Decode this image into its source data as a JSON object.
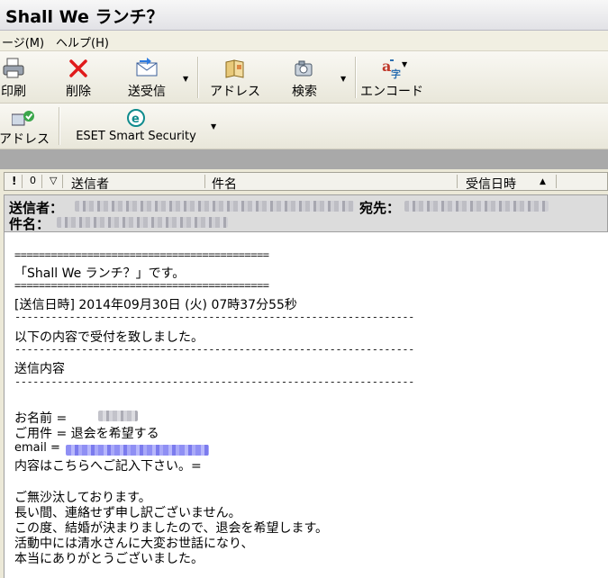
{
  "window": {
    "title": "Shall We ランチ？"
  },
  "menubar": {
    "items": [
      "ージ(M)",
      "ヘルプ(H)"
    ]
  },
  "toolbar": {
    "buttons": [
      {
        "label": "印刷",
        "icon": "printer-icon"
      },
      {
        "label": "削除",
        "icon": "delete-x-icon"
      },
      {
        "label": "送受信",
        "icon": "send-receive-icon"
      },
      {
        "label": "アドレス",
        "icon": "address-book-icon"
      },
      {
        "label": "検索",
        "icon": "search-icon"
      },
      {
        "label": "エンコード",
        "icon": "encoding-icon"
      }
    ]
  },
  "toolbar2": {
    "buttons": [
      {
        "label": "アドレス",
        "icon": "address-check-icon"
      },
      {
        "label": "ESET Smart Security",
        "icon": "eset-icon"
      }
    ]
  },
  "list_header": {
    "flag_icons": [
      "!",
      "0",
      "▽"
    ],
    "columns": [
      "送信者",
      "件名",
      "受信日時"
    ]
  },
  "message_header": {
    "from_label": "送信者：",
    "to_label": "宛先：",
    "subject_label": "件名："
  },
  "body": {
    "rule_double": "==========================================",
    "rule_single": "------------------------------------------------------------------",
    "lines": [
      "「Shall We ランチ？」です。",
      "[送信日時] 2014年09月30日 (火) 07時37分55秒",
      "以下の内容で受付を致しました。",
      "送信内容",
      "お名前 =",
      " ご用件 = 退会を希望する",
      " email =",
      " 内容はこちらへご記入下さい。=",
      "ご無沙汰しております。",
      "長い間、連絡せず申し訳ございません。",
      "この度、結婚が決まりましたので、退会を希望します。",
      "活動中には清水さんに大変お世話になり、",
      "本当にありがとうございました。"
    ]
  },
  "colors": {
    "accent_red": "#e01b1b",
    "link_blue": "#8f8ff4",
    "eset_teal": "#0f8b8d"
  }
}
